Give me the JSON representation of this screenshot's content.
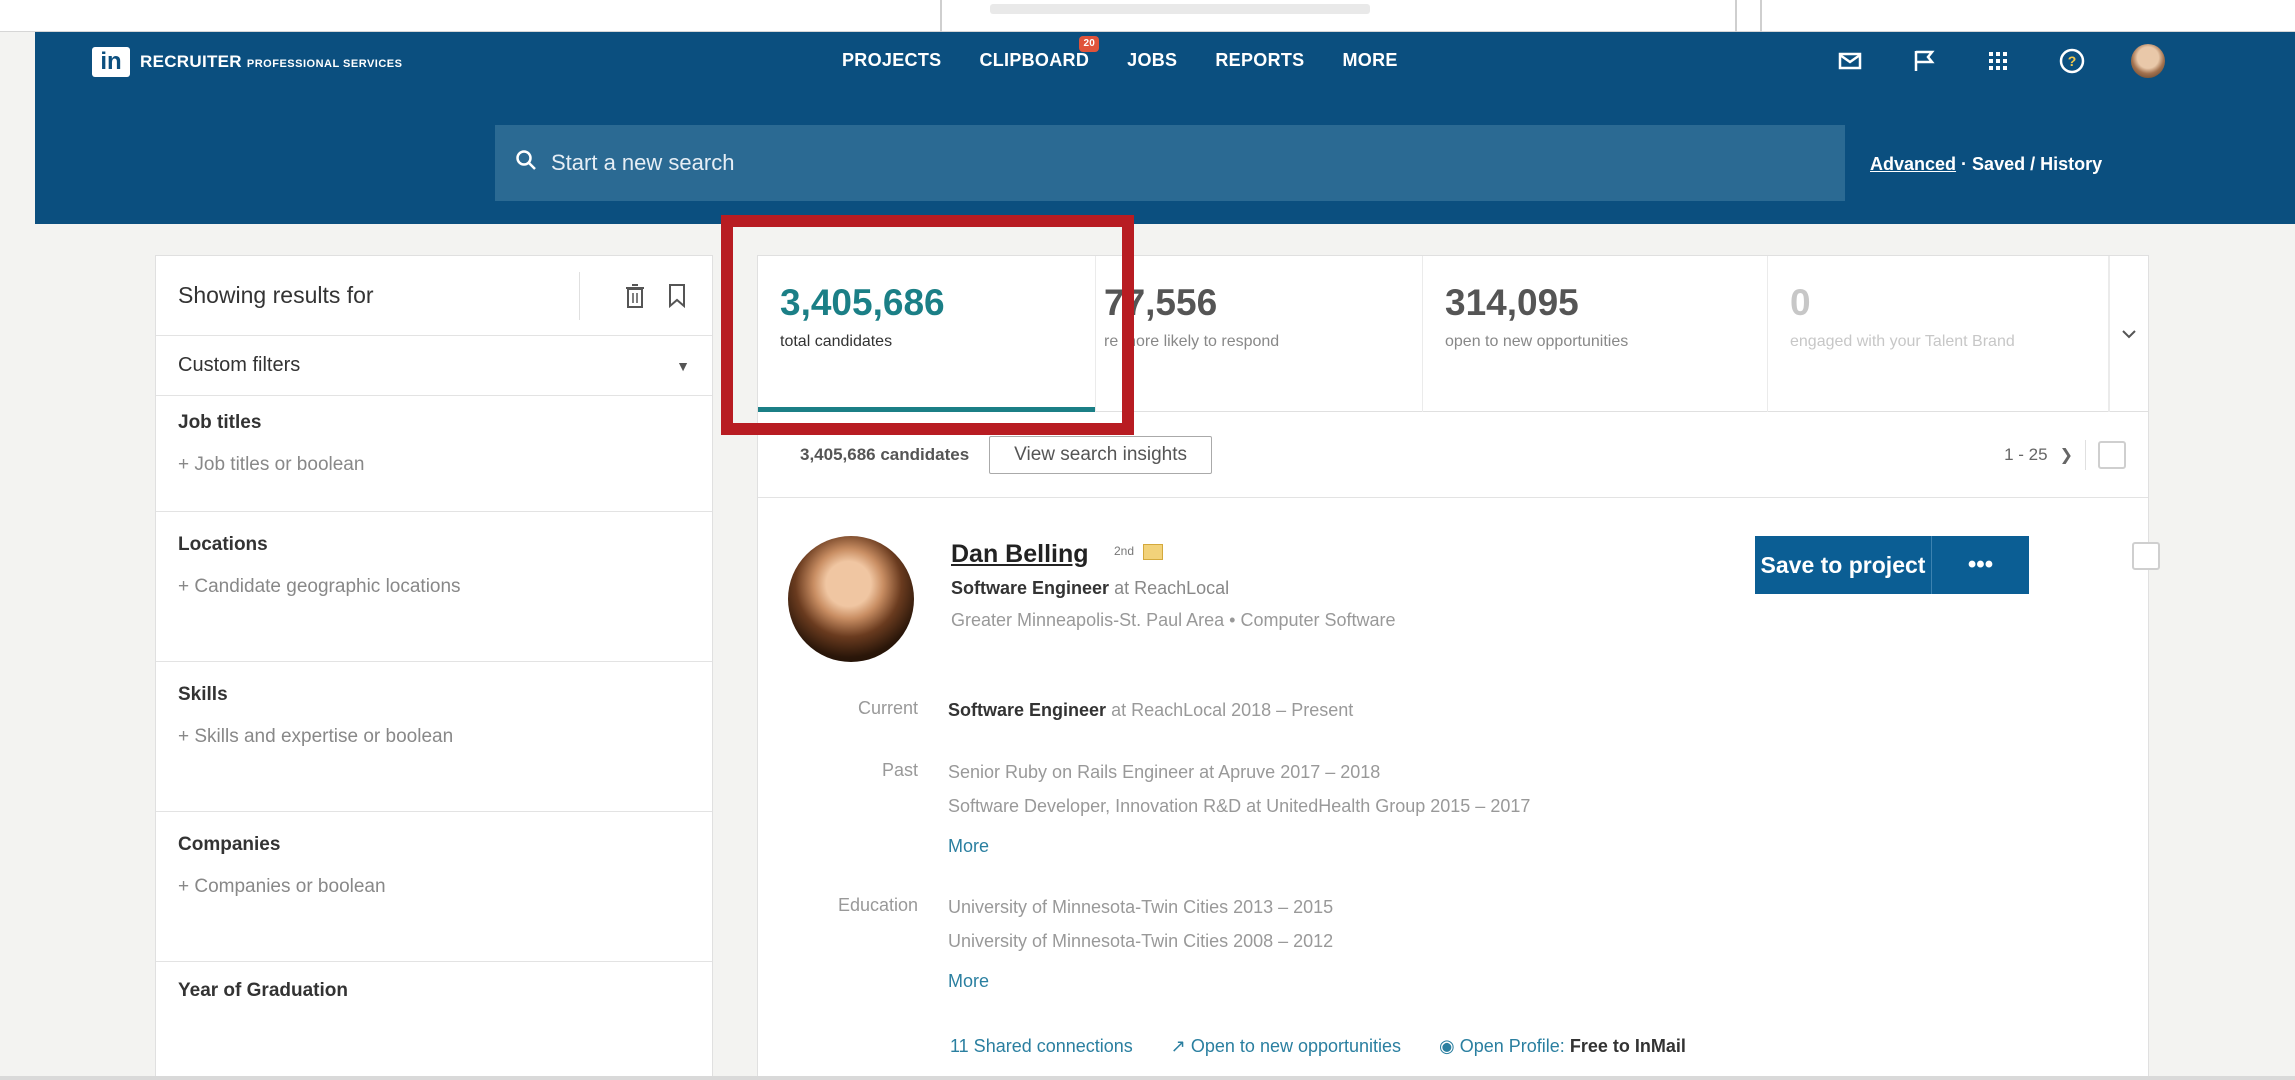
{
  "app": {
    "name": "RECRUITER",
    "subtitle": "PROFESSIONAL SERVICES",
    "logo_text": "in"
  },
  "nav": {
    "items": [
      "PROJECTS",
      "CLIPBOARD",
      "JOBS",
      "REPORTS",
      "MORE"
    ],
    "clipboard_badge": "20"
  },
  "header_icons": [
    "mail-icon",
    "flag-icon",
    "apps-grid-icon",
    "help-icon",
    "profile-avatar"
  ],
  "search": {
    "placeholder": "Start a new search",
    "advanced_label": "Advanced",
    "saved_history_label": "Saved / History"
  },
  "filters": {
    "title": "Showing results for",
    "custom_filters": "Custom filters",
    "sections": [
      {
        "title": "Job titles",
        "add": "Job titles or boolean"
      },
      {
        "title": "Locations",
        "add": "Candidate geographic locations"
      },
      {
        "title": "Skills",
        "add": "Skills and expertise or boolean"
      },
      {
        "title": "Companies",
        "add": "Companies or boolean"
      },
      {
        "title": "Year of Graduation",
        "add": ""
      }
    ]
  },
  "tabs": [
    {
      "count": "3,405,686",
      "label": "total candidates"
    },
    {
      "count": "77,556",
      "label": "re more likely to respond"
    },
    {
      "count": "314,095",
      "label": "open to new opportunities"
    },
    {
      "count": "0",
      "label": "engaged with your Talent Brand"
    }
  ],
  "results": {
    "count_label": "3,405,686 candidates",
    "insights_button": "View search insights",
    "pagination": "1 - 25"
  },
  "candidate": {
    "name": "Dan Belling",
    "degree": "2nd",
    "headline_title": "Software Engineer",
    "headline_company": "at ReachLocal",
    "location": "Greater Minneapolis-St. Paul Area",
    "industry": "Computer Software",
    "current_label": "Current",
    "current_title": "Software Engineer",
    "current_rest": "at ReachLocal  2018 – Present",
    "past_label": "Past",
    "past": [
      "Senior Ruby on Rails Engineer at Apruve  2017 – 2018",
      "Software Developer, Innovation R&D at UnitedHealth Group  2015 – 2017"
    ],
    "education_label": "Education",
    "education": [
      "University of Minnesota-Twin Cities  2013 – 2015",
      "University of Minnesota-Twin Cities  2008 – 2012"
    ],
    "more_label": "More",
    "save_button": "Save to project",
    "more_button": "•••",
    "shared_connections": "11 Shared connections",
    "open_to_new": "Open to new opportunities",
    "open_profile": "Open Profile:",
    "free_inmail": "Free to InMail"
  },
  "colors": {
    "header_bg": "#0b4f7f",
    "search_bg": "#2b6a93",
    "accent_teal": "#1b7f86",
    "save_button": "#0b5e94",
    "highlight_red": "#b81c22"
  }
}
